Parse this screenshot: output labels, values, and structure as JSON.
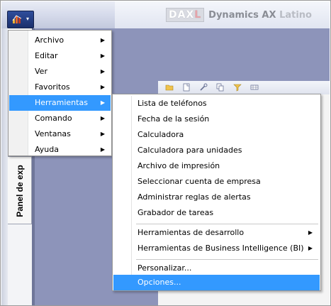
{
  "logo": {
    "box_prefix": "DAX",
    "box_last": "L",
    "text_main": "Dynamics AX",
    "text_latino": "Latino"
  },
  "app_button": {
    "icon": "dynamics-chart-icon",
    "caret": "▾"
  },
  "left_panel": {
    "tab_label": "Panel de exp"
  },
  "colors": {
    "workspace": "#8d94ba",
    "highlight": "#3399ff",
    "app_button": "#1b2f6b"
  },
  "main_menu": {
    "items": [
      {
        "label": "Archivo",
        "submenu": true
      },
      {
        "label": "Editar",
        "submenu": true
      },
      {
        "label": "Ver",
        "submenu": true
      },
      {
        "label": "Favoritos",
        "submenu": true
      },
      {
        "label": "Herramientas",
        "submenu": true,
        "active": true
      },
      {
        "label": "Comando",
        "submenu": true
      },
      {
        "label": "Ventanas",
        "submenu": true
      },
      {
        "label": "Ayuda",
        "submenu": true
      }
    ],
    "arrow": "▶"
  },
  "tools_menu": {
    "items": [
      {
        "label": "Lista de teléfonos"
      },
      {
        "label": "Fecha de la sesión"
      },
      {
        "label": "Calculadora"
      },
      {
        "label": "Calculadora para unidades"
      },
      {
        "label": "Archivo de impresión"
      },
      {
        "label": "Seleccionar cuenta de empresa"
      },
      {
        "label": "Administrar reglas de alertas"
      },
      {
        "label": "Grabador de tareas"
      },
      {
        "label": "Herramientas de desarrollo",
        "submenu": true
      },
      {
        "label": "Herramientas de Business Intelligence (BI)",
        "submenu": true
      },
      {
        "label": "Personalizar..."
      },
      {
        "label": "Opciones...",
        "active": true
      }
    ]
  }
}
